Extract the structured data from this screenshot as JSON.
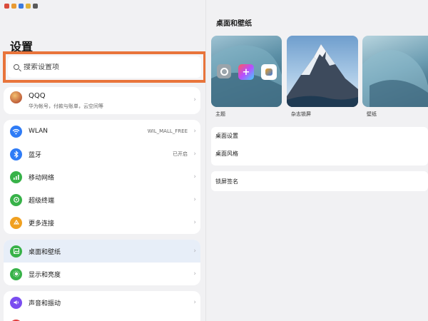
{
  "left": {
    "title": "设置",
    "search": {
      "placeholder": "搜索设置项"
    },
    "account": {
      "label": "QQQ",
      "sub": "华为帐号，付款与账单，云空间等"
    },
    "connectivity": [
      {
        "label": "WLAN",
        "value": "WIL_MALL_FREE",
        "icon": "wifi-icon",
        "color": "#2f7cf6"
      },
      {
        "label": "蓝牙",
        "value": "已开启",
        "icon": "bluetooth-icon",
        "color": "#2f7cf6"
      },
      {
        "label": "移动网络",
        "value": "",
        "icon": "mobile-network-icon",
        "color": "#38b249"
      },
      {
        "label": "超级终端",
        "value": "",
        "icon": "super-device-icon",
        "color": "#38b249"
      },
      {
        "label": "更多连接",
        "value": "",
        "icon": "more-connections-icon",
        "color": "#f0a020"
      }
    ],
    "display": [
      {
        "label": "桌面和壁纸",
        "icon": "home-screen-wallpaper-icon",
        "color": "#38b249"
      },
      {
        "label": "显示和亮度",
        "icon": "display-brightness-icon",
        "color": "#38b249"
      }
    ],
    "sound": [
      {
        "label": "声音和振动",
        "icon": "sound-vibration-icon",
        "color": "#7a4df0"
      },
      {
        "label": "",
        "icon": "notification-icon",
        "color": "#e23d3d"
      }
    ]
  },
  "right": {
    "title": "桌面和壁纸",
    "themes": [
      {
        "label": "主题"
      },
      {
        "label": "杂志锁屏"
      },
      {
        "label": "壁纸"
      }
    ],
    "items": [
      {
        "label": "桌面设置"
      },
      {
        "label": "桌面风格"
      },
      {
        "label": "锁屏签名"
      }
    ]
  },
  "colors": {
    "accent": "#e8743b",
    "selected_bg": "#e7eef8"
  }
}
